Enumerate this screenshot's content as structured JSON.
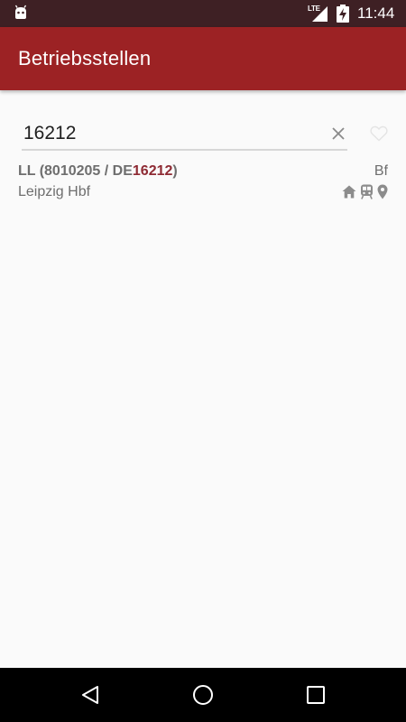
{
  "status_bar": {
    "network_label": "LTE",
    "time": "11:44"
  },
  "app_bar": {
    "title": "Betriebsstellen"
  },
  "search": {
    "value": "16212",
    "underline_color": "#d7d7d7"
  },
  "results": [
    {
      "code_prefix": "LL (8010205 / DE",
      "code_highlight": "16212",
      "code_suffix": ")",
      "name": "Leipzig Hbf",
      "type": "Bf",
      "icons": [
        "home-icon",
        "train-icon",
        "location-pin-icon"
      ]
    }
  ],
  "colors": {
    "status_bar": "#3e2024",
    "app_bar": "#9c2224",
    "highlight": "#8e2a33",
    "background": "#fafafa",
    "secondary_text": "#6e6e6e"
  },
  "icons": {
    "status_left": "android-icon",
    "signal": "signal-icon",
    "battery": "battery-charging-icon",
    "clear": "close-icon",
    "favorite": "heart-outline-icon",
    "nav_back": "back-triangle-icon",
    "nav_home": "home-circle-icon",
    "nav_recents": "recents-square-icon"
  }
}
